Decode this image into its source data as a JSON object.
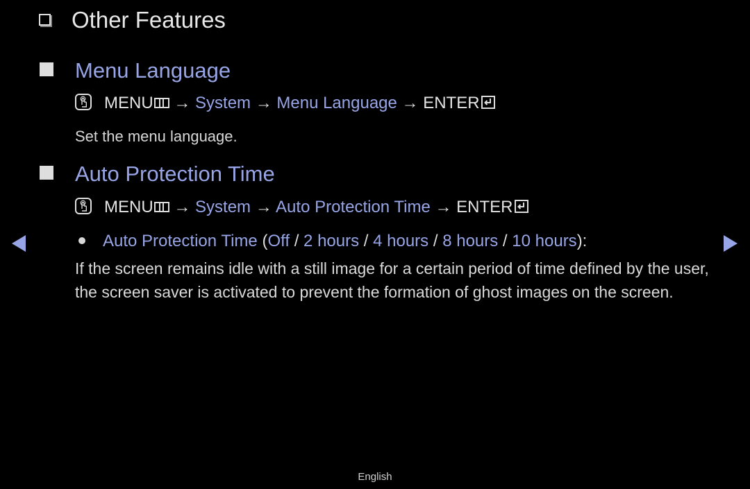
{
  "page": {
    "title": "Other Features",
    "footer_language": "English"
  },
  "colors": {
    "accent": "#97a5e6",
    "text": "#dcdcdc",
    "background": "#000000"
  },
  "sections": [
    {
      "heading": "Menu Language",
      "path": {
        "menu": "MENU",
        "arrow": "→",
        "step1": "System",
        "step2": "Menu Language",
        "enter": "ENTER"
      },
      "description": "Set the menu language."
    },
    {
      "heading": "Auto Protection Time",
      "path": {
        "menu": "MENU",
        "arrow": "→",
        "step1": "System",
        "step2": "Auto Protection Time",
        "enter": "ENTER"
      },
      "bullet": {
        "label": "Auto Protection Time",
        "open": " (",
        "options": [
          "Off",
          "2 hours",
          "4 hours",
          "8 hours",
          "10 hours"
        ],
        "sep": " / ",
        "close": "):"
      },
      "description": "If the screen remains idle with a still image for a certain period of time defined by the user, the screen saver is activated to prevent the formation of ghost images on the screen."
    }
  ],
  "nav": {
    "prev_icon": "triangle-left-icon",
    "next_icon": "triangle-right-icon"
  }
}
